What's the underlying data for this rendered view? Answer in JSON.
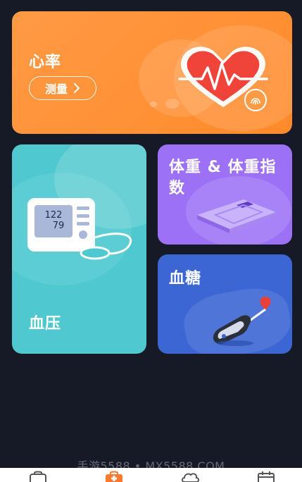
{
  "cards": {
    "heart_rate": {
      "title": "心率",
      "button_label": "测量",
      "button_chevron": "chevron-right-icon"
    },
    "blood_pressure": {
      "title": "血压",
      "display_top": "122",
      "display_bottom": "79"
    },
    "weight": {
      "title": "体重 & 体重指数"
    },
    "glucose": {
      "title": "血糖"
    }
  },
  "watermark": "手游5588 • MX5588.COM",
  "bottom_nav": {
    "items": [
      {
        "icon": "bag-icon"
      },
      {
        "icon": "medical-kit-icon",
        "active": true
      },
      {
        "icon": "cloud-icon"
      },
      {
        "icon": "calendar-icon"
      }
    ]
  },
  "colors": {
    "background": "#161a27",
    "heart_card": "#ff8f36",
    "bp_card": "#4fc9cf",
    "weight_card": "#9d71f6",
    "glucose_card": "#3b66d4",
    "active_nav": "#ff7a2f"
  }
}
